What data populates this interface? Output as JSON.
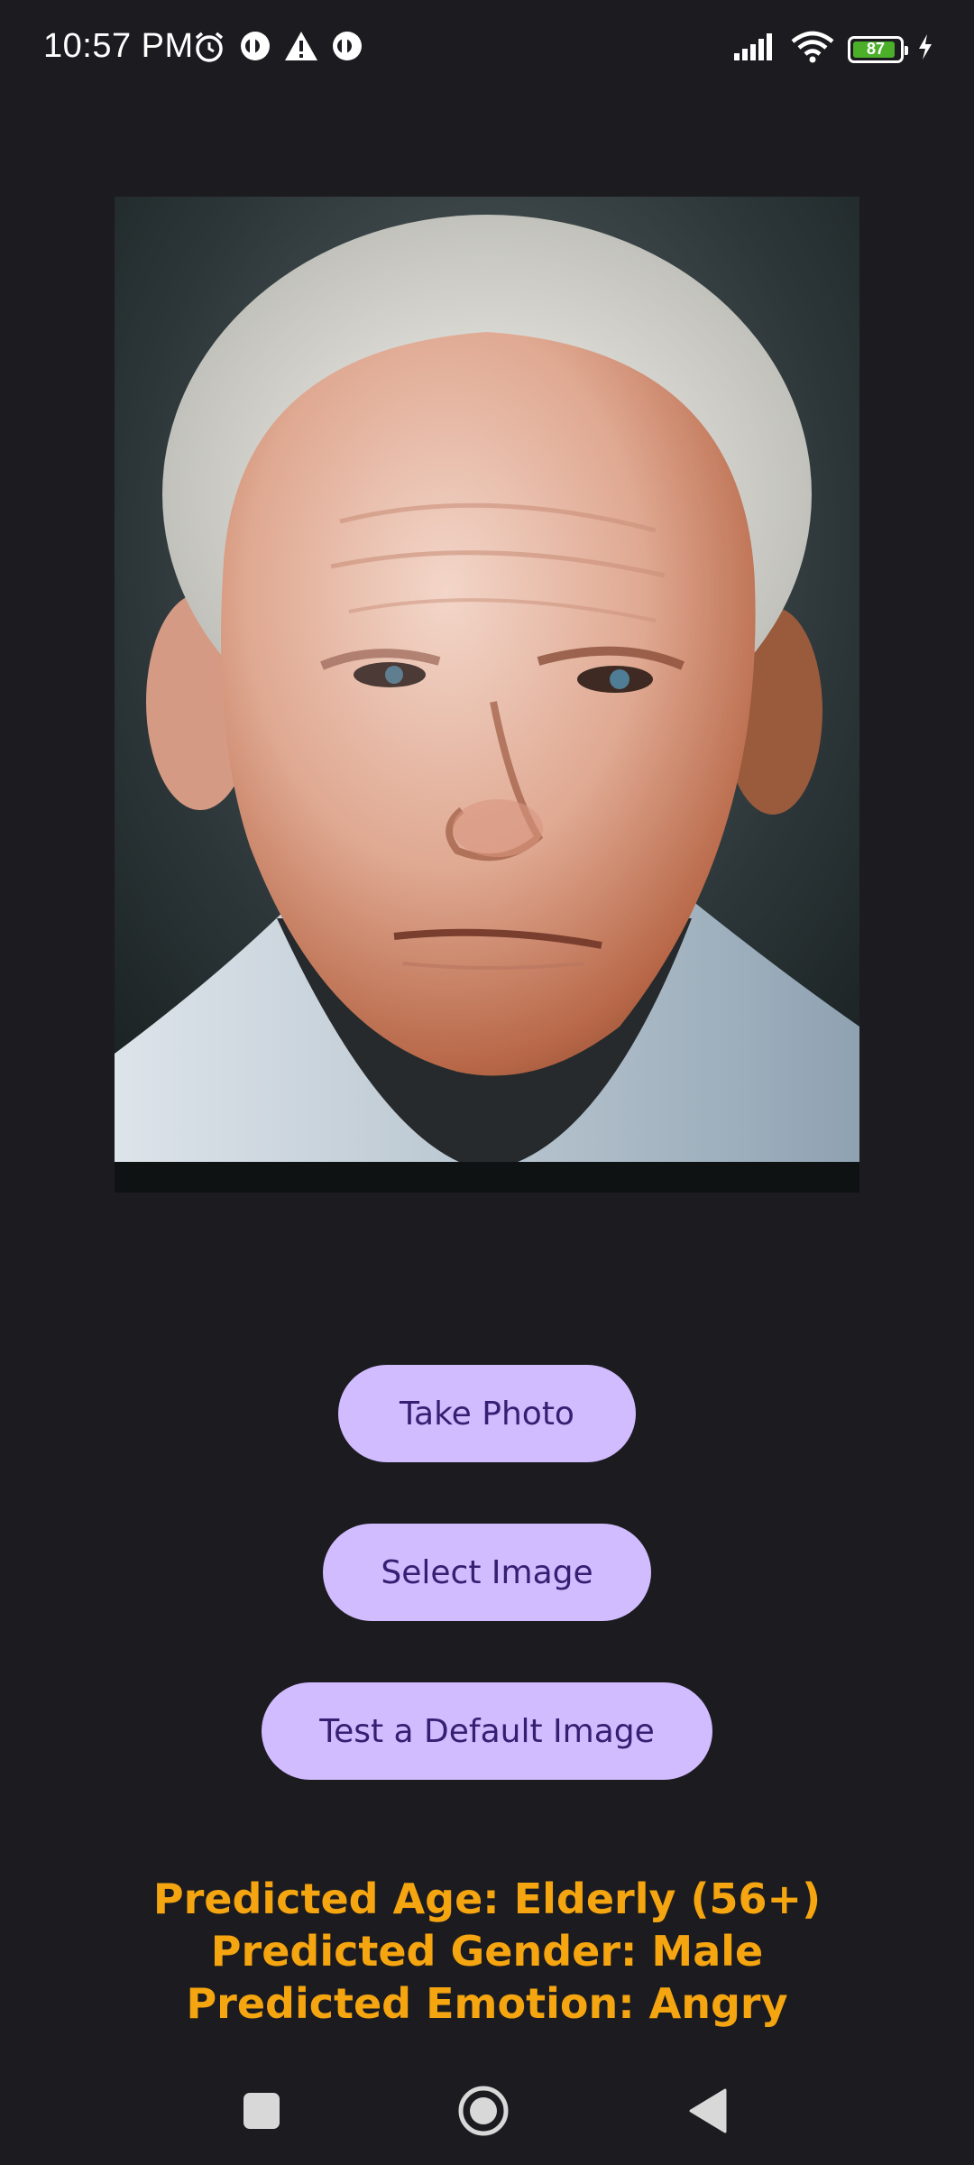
{
  "status_bar": {
    "time": "10:57 PM",
    "battery_level": "87",
    "icons_left": [
      "alarm-icon",
      "app-notification-icon",
      "warning-icon",
      "app-notification-icon"
    ],
    "icons_right": [
      "signal-icon",
      "wifi-icon",
      "battery-icon",
      "charging-icon"
    ]
  },
  "photo": {
    "icon": "portrait-photo"
  },
  "buttons": {
    "take_photo": "Take Photo",
    "select_image": "Select Image",
    "test_default": "Test a Default Image"
  },
  "results": {
    "age": "Predicted Age: Elderly (56+)",
    "gender": "Predicted Gender: Male",
    "emotion": "Predicted Emotion: Angry"
  },
  "nav_bar": {
    "icons": [
      "recents-icon",
      "home-icon",
      "back-icon"
    ]
  },
  "colors": {
    "background": "#1c1b20",
    "button_bg": "#d0bcff",
    "button_text": "#381e72",
    "result_text": "#f5a50f",
    "battery_fill": "#4caf2a"
  }
}
